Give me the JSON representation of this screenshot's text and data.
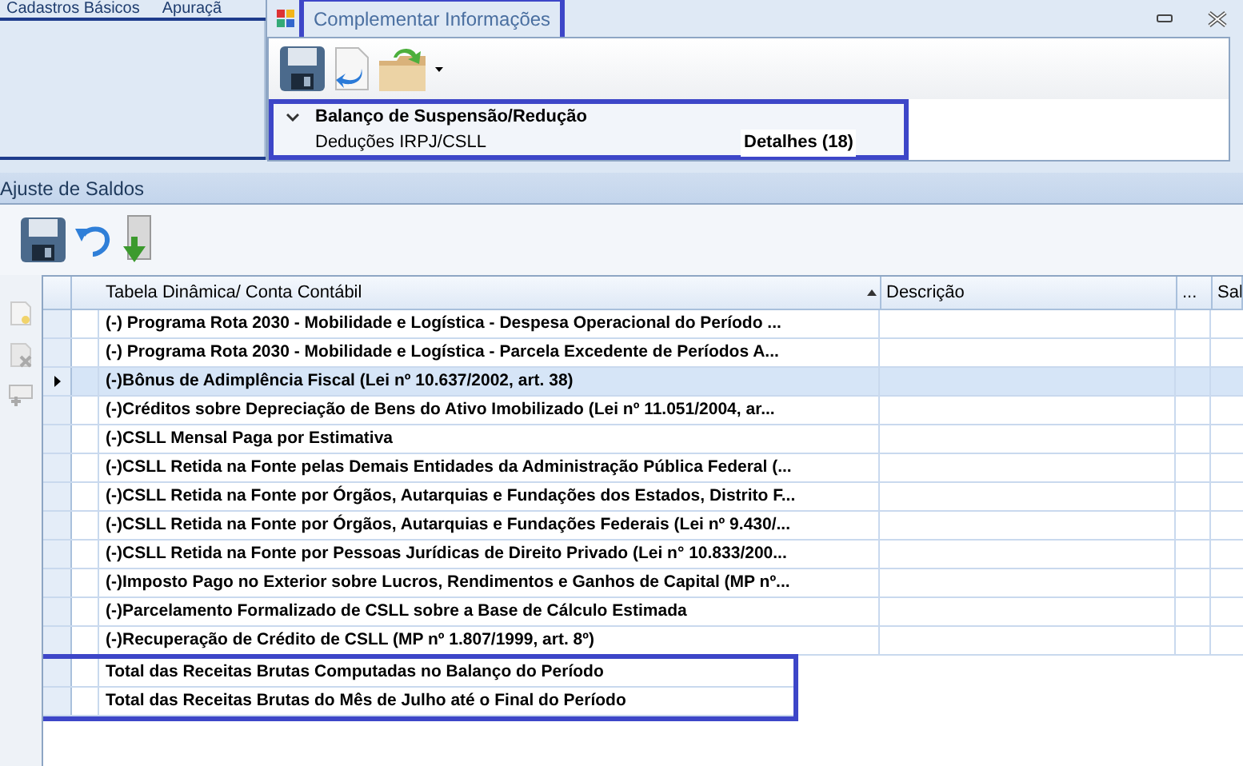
{
  "ribbon": {
    "tabs": [
      "Cadastros Básicos",
      "Apuraçã"
    ]
  },
  "dialog": {
    "title": "Complementar Informações",
    "title_highlighted": true,
    "group": {
      "title": "Balanço de Suspensão/Redução",
      "expanded": true,
      "highlighted": true,
      "rows": [
        {
          "label": "Deduções IRPJ/CSLL",
          "details": "Detalhes (18)"
        }
      ]
    }
  },
  "panel": {
    "title": "Ajuste de Saldos"
  },
  "grid": {
    "columns": [
      {
        "label": "Tabela Dinâmica/ Conta Contábil",
        "sorted": true
      },
      {
        "label": "Descrição",
        "sorted": false
      },
      {
        "label": "...",
        "sorted": false
      },
      {
        "label": "Sal",
        "sorted": false
      }
    ],
    "rows": [
      {
        "text": "(-) Programa Rota 2030 - Mobilidade e Logística - Despesa Operacional do Período ...",
        "selected": false,
        "highlighted": false
      },
      {
        "text": "(-) Programa Rota 2030 - Mobilidade e Logística - Parcela Excedente de Períodos A...",
        "selected": false,
        "highlighted": false
      },
      {
        "text": "(-)Bônus de Adimplência Fiscal (Lei nº 10.637/2002, art. 38)",
        "selected": true,
        "highlighted": false
      },
      {
        "text": "(-)Créditos sobre Depreciação de Bens do Ativo Imobilizado (Lei nº 11.051/2004, ar...",
        "selected": false,
        "highlighted": false
      },
      {
        "text": "(-)CSLL Mensal Paga por Estimativa",
        "selected": false,
        "highlighted": false
      },
      {
        "text": "(-)CSLL Retida na Fonte pelas Demais Entidades da Administração Pública Federal (...",
        "selected": false,
        "highlighted": false
      },
      {
        "text": "(-)CSLL Retida na Fonte por Órgãos, Autarquias e Fundações dos Estados, Distrito F...",
        "selected": false,
        "highlighted": false
      },
      {
        "text": "(-)CSLL Retida na Fonte por Órgãos, Autarquias e Fundações Federais (Lei nº 9.430/...",
        "selected": false,
        "highlighted": false
      },
      {
        "text": "(-)CSLL Retida na Fonte por Pessoas Jurídicas de Direito Privado (Lei n° 10.833/200...",
        "selected": false,
        "highlighted": false
      },
      {
        "text": "(-)Imposto Pago no Exterior sobre Lucros, Rendimentos e Ganhos de Capital (MP nº...",
        "selected": false,
        "highlighted": false
      },
      {
        "text": "(-)Parcelamento Formalizado de CSLL sobre a Base de Cálculo Estimada",
        "selected": false,
        "highlighted": false
      },
      {
        "text": "(-)Recuperação de Crédito de CSLL (MP nº 1.807/1999, art. 8º)",
        "selected": false,
        "highlighted": false
      },
      {
        "text": "Total das Receitas Brutas Computadas no Balanço do Período",
        "selected": false,
        "highlighted": true
      },
      {
        "text": "Total das Receitas Brutas do Mês de Julho até o Final do Período",
        "selected": false,
        "highlighted": true
      }
    ]
  }
}
